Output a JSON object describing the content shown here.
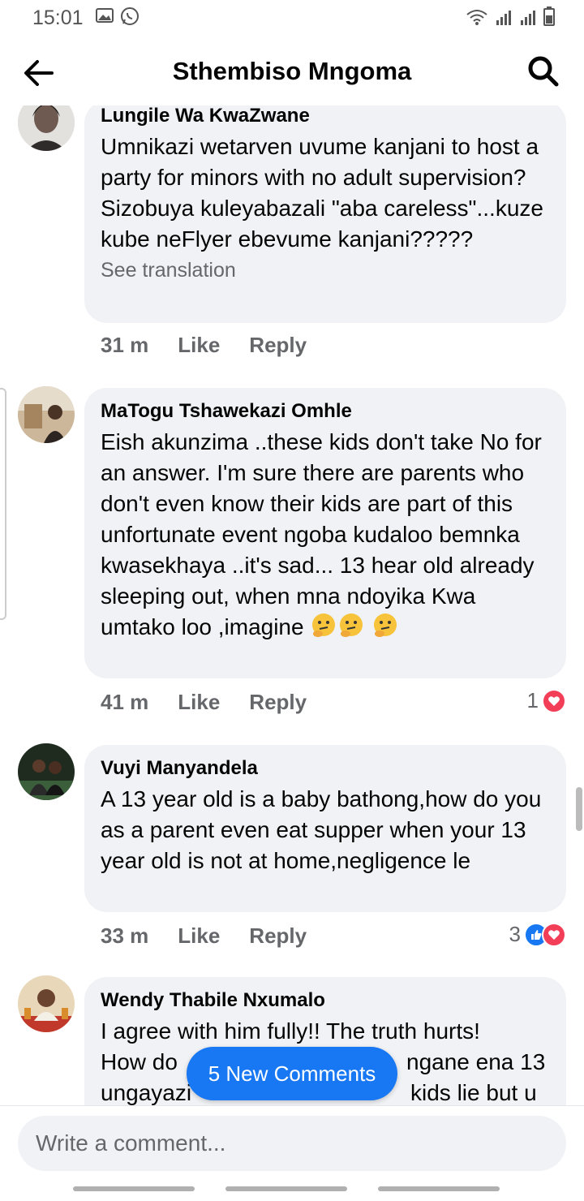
{
  "status_bar": {
    "time": "15:01",
    "left_icons": [
      "gallery-icon",
      "whatsapp-icon"
    ],
    "right_icons": [
      "wifi-icon",
      "signal-icon",
      "signal-icon",
      "battery-icon"
    ]
  },
  "header": {
    "title": "Sthembiso Mngoma",
    "back_icon": "arrow-left-icon",
    "search_icon": "search-icon"
  },
  "comments": [
    {
      "author": "Lungile Wa KwaZwane",
      "text": "Umnikazi wetarven uvume kanjani to host a party for minors with no adult supervision? Sizobuya kuleyabazali \"aba careless\"...kuze kube neFlyer ebevume kanjani?????",
      "see_translation": "See translation",
      "time": "31 m",
      "like": "Like",
      "reply": "Reply"
    },
    {
      "author": "MaTogu Tshawekazi Omhle",
      "text": "Eish akunzima ..these kids don't take No for an answer. I'm sure there are parents who don't even know their kids are part of this unfortunate event ngoba kudaloo bemnka kwasekhaya ..it's sad... 13 hear old already sleeping out, when mna ndoyika Kwa umtako loo ,imagine",
      "emojis": [
        "thinking-face",
        "thinking-face",
        "thinking-face"
      ],
      "time": "41 m",
      "like": "Like",
      "reply": "Reply",
      "reaction_count": "1",
      "reactions": [
        "love"
      ]
    },
    {
      "author": "Vuyi Manyandela",
      "text": "A 13 year old is a baby bathong,how do you as a parent even eat supper when your 13 year old is not at home,negligence le",
      "time": "33 m",
      "like": "Like",
      "reply": "Reply",
      "reaction_count": "3",
      "reactions": [
        "like",
        "love"
      ]
    },
    {
      "author": "Wendy Thabile Nxumalo",
      "text_line1": "I agree with him fully!! The truth hurts!",
      "text_line2_left": "How do",
      "text_line2_right": "ngane ena 13",
      "text_line3_left": "ungayazi",
      "text_line3_right": "kids lie but u"
    }
  ],
  "new_comments_button": "5 New Comments",
  "composer": {
    "placeholder": "Write a comment..."
  },
  "colors": {
    "accent": "#1877f2",
    "bubble": "#f0f2f5",
    "secondary_text": "#65676b",
    "love": "#f33e58"
  }
}
